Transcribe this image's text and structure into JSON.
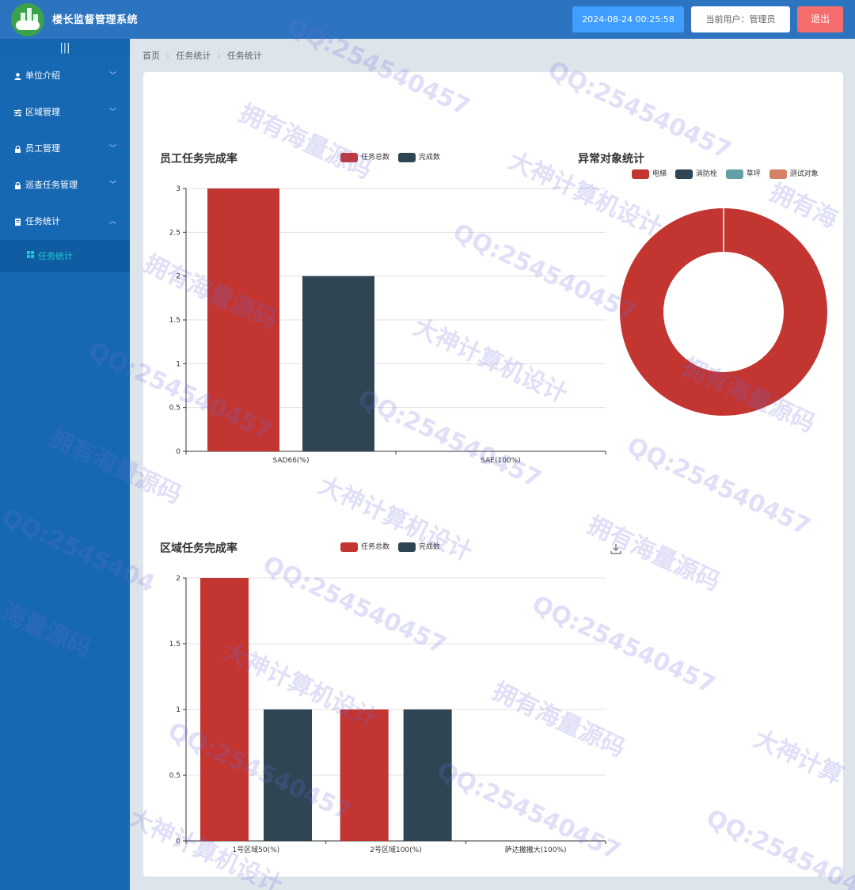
{
  "header": {
    "app_title": "楼长监督管理系统",
    "datetime": "2024-08-24 00:25:58",
    "current_user": "当前用户：管理员",
    "logout_label": "退出"
  },
  "sidebar": {
    "collapse_glyph": "|||",
    "items": [
      {
        "label": "单位介绍",
        "icon": "user-icon"
      },
      {
        "label": "区域管理",
        "icon": "sliders-icon"
      },
      {
        "label": "员工管理",
        "icon": "lock-icon"
      },
      {
        "label": "巡查任务管理",
        "icon": "lock-icon"
      },
      {
        "label": "任务统计",
        "icon": "document-icon"
      }
    ],
    "sub_items": [
      {
        "label": "任务统计",
        "icon": "grid-icon"
      }
    ]
  },
  "breadcrumb": [
    "首页",
    "任务统计",
    "任务统计"
  ],
  "colors": {
    "red": "#c23531",
    "navy": "#2f4554",
    "teal": "#61a0a8",
    "orange": "#d48265"
  },
  "chart_data": [
    {
      "type": "bar",
      "title": "员工任务完成率",
      "categories": [
        "SAD66(%)",
        "SAE(100%)"
      ],
      "series": [
        {
          "name": "任务总数",
          "values": [
            3,
            0
          ]
        },
        {
          "name": "完成数",
          "values": [
            2,
            0
          ]
        }
      ],
      "ylim": [
        0,
        3
      ],
      "yticks": [
        "0",
        "0.5",
        "1",
        "1.5",
        "2",
        "2.5",
        "3"
      ],
      "grid": true,
      "legend_position": "top"
    },
    {
      "type": "pie",
      "title": "异常对象统计",
      "donut": true,
      "slices": [
        {
          "name": "电梯",
          "value": 1
        },
        {
          "name": "消防栓",
          "value": 0
        },
        {
          "name": "草坪",
          "value": 0
        },
        {
          "name": "测试对象",
          "value": 0
        }
      ],
      "legend_position": "top"
    },
    {
      "type": "bar",
      "title": "区域任务完成率",
      "categories": [
        "1号区域50(%)",
        "2号区域100(%)",
        "萨达撒撒大(100%)"
      ],
      "series": [
        {
          "name": "任务总数",
          "values": [
            2,
            1,
            0
          ]
        },
        {
          "name": "完成数",
          "values": [
            1,
            1,
            0
          ]
        }
      ],
      "ylim": [
        0,
        2
      ],
      "yticks": [
        "0",
        "0.5",
        "1",
        "1.5",
        "2"
      ],
      "grid": true,
      "legend_position": "top"
    }
  ]
}
